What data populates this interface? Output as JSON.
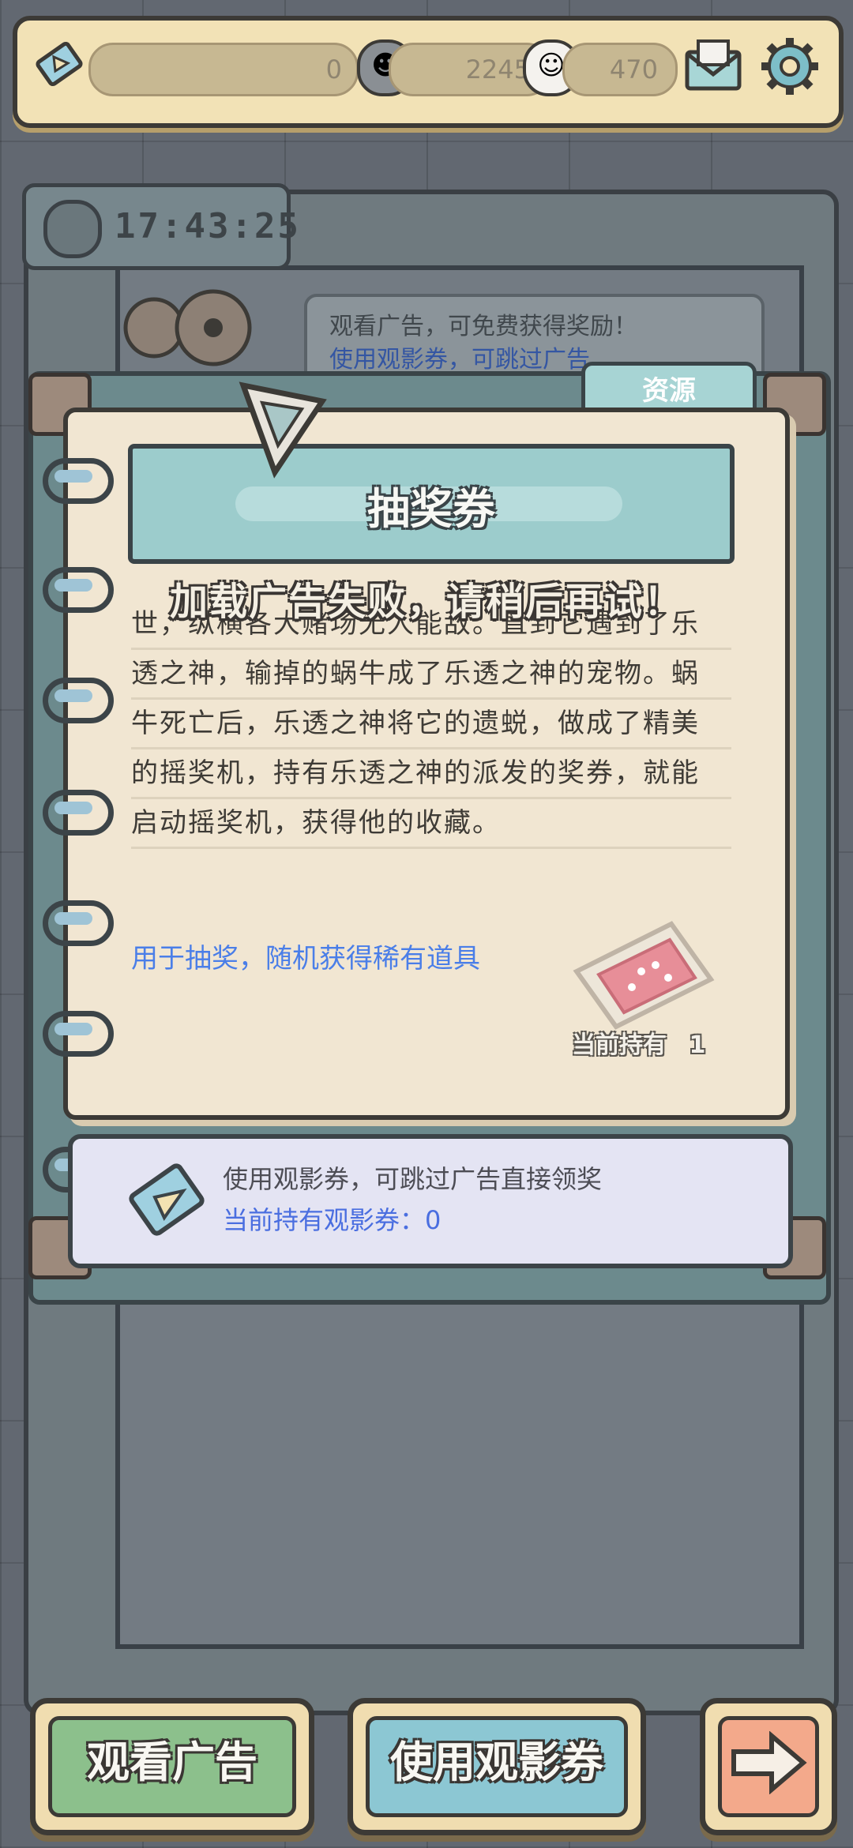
{
  "topbar": {
    "energy_value": "0",
    "coin_value": "2245",
    "ghost_value": "470",
    "icons": [
      "film-ticket-icon",
      "skull-coin-icon",
      "ghost-icon",
      "mail-icon",
      "gear-icon"
    ]
  },
  "timer": {
    "time": "17:43:25"
  },
  "ad_bubble": {
    "line1": "观看广告，可免费获得奖励！",
    "line2": "使用观影券，可跳过广告"
  },
  "dialog": {
    "tab_label": "资源",
    "title": "抽奖券",
    "toast": "加载广告失败，请稍后再试！",
    "story_lines": [
      "世，纵横各大赌场无人能敌。直到它遇到了乐",
      "透之神，输掉的蜗牛成了乐透之神的宠物。蜗",
      "牛死亡后，乐透之神将它的遗蜕，做成了精美",
      "的摇奖机，持有乐透之神的派发的奖券，就能",
      "启动摇奖机，获得他的收藏。"
    ],
    "use_description": "用于抽奖，随机获得稀有道具",
    "owned_label": "当前持有",
    "owned_count": "1"
  },
  "voucher": {
    "line1": "使用观影券，可跳过广告直接领奖",
    "line2": "当前持有观影券：0"
  },
  "buttons": {
    "watch_ad": "观看广告",
    "use_voucher": "使用观影券"
  },
  "colors": {
    "paper": "#f1e6d2",
    "teal": "#9ccccc",
    "link_blue": "#4a7ee8",
    "green_button": "#8cc08c",
    "blue_button": "#8cc7d3",
    "orange_button": "#f3a98b"
  }
}
